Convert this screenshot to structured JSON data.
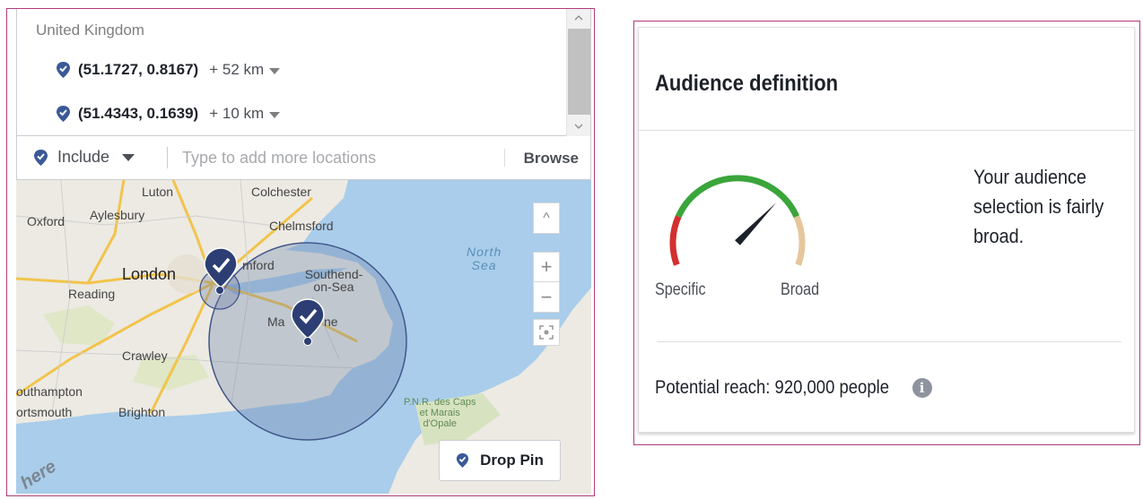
{
  "locations": {
    "country": "United Kingdom",
    "items": [
      {
        "coord": "(51.1727, 0.8167)",
        "radius": "+ 52 km"
      },
      {
        "coord": "(51.4343, 0.1639)",
        "radius": "+ 10 km"
      }
    ],
    "include_label": "Include",
    "input_placeholder": "Type to add more locations",
    "browse_label": "Browse"
  },
  "map": {
    "labels": {
      "luton": "Luton",
      "colchester": "Colchester",
      "oxford": "Oxford",
      "aylesbury": "Aylesbury",
      "chelmsford": "Chelmsford",
      "london": "London",
      "romford": "mford",
      "southend": "Southend-\non-Sea",
      "reading": "Reading",
      "maidstone_a": "Ma",
      "maidstone_b": "ne",
      "crawley": "Crawley",
      "southampton": "outhampton",
      "portsmouth": "ortsmouth",
      "brighton": "Brighton",
      "north_sea": "North\nSea",
      "pnr": "P.N.R. des Caps\net Marais\nd'Opale"
    },
    "controls": {
      "collapse": "^",
      "zoom_in": "+",
      "zoom_out": "−"
    },
    "drop_pin_label": "Drop Pin",
    "logo": "here"
  },
  "audience": {
    "title": "Audience definition",
    "gauge_specific": "Specific",
    "gauge_broad": "Broad",
    "description": "Your audience selection is fairly broad.",
    "potential_reach": "Potential reach: 920,000 people",
    "info_glyph": "i",
    "gauge_level": 0.7
  },
  "colors": {
    "pin": "#3b5998",
    "panel_border": "#b23a7a",
    "gauge_red": "#d32f2f",
    "gauge_green": "#3aa53a",
    "gauge_tan": "#e6c79c"
  }
}
